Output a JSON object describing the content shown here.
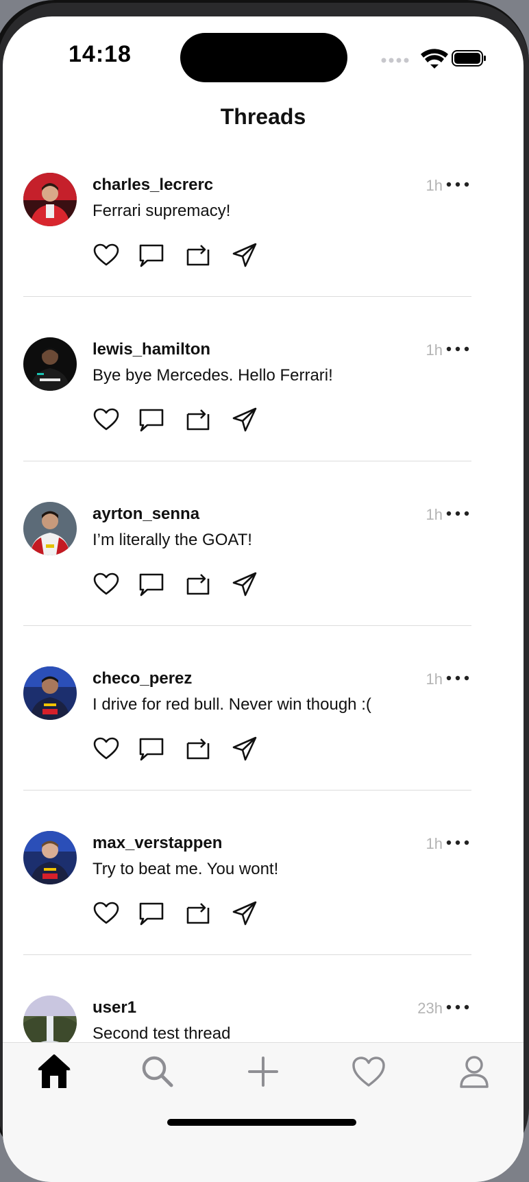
{
  "status_bar": {
    "time": "14:18"
  },
  "nav": {
    "title": "Threads"
  },
  "threads": [
    {
      "username": "charles_lecrerc",
      "time": "1h",
      "content": "Ferrari supremacy!",
      "avatar": "avatar-red-suit"
    },
    {
      "username": "lewis_hamilton",
      "time": "1h",
      "content": "Bye bye Mercedes. Hello Ferrari!",
      "avatar": "avatar-black-suit"
    },
    {
      "username": "ayrton_senna",
      "time": "1h",
      "content": "I’m literally the GOAT!",
      "avatar": "avatar-red-white-suit"
    },
    {
      "username": "checo_perez",
      "time": "1h",
      "content": "I drive for red bull. Never win though :(",
      "avatar": "avatar-redbull-suit"
    },
    {
      "username": "max_verstappen",
      "time": "1h",
      "content": "Try to beat me. You wont!",
      "avatar": "avatar-redbull-suit"
    },
    {
      "username": "user1",
      "time": "23h",
      "content": "Second test thread",
      "avatar": "avatar-waterfall"
    }
  ],
  "action_icons": [
    "heart-icon",
    "comment-icon",
    "repost-icon",
    "send-icon"
  ],
  "tabs": [
    "home-icon",
    "search-icon",
    "plus-icon",
    "heart-icon",
    "profile-icon"
  ],
  "colors": {
    "muted_time": "#b4b4b4",
    "divider": "#dcdcdc",
    "inactive_tab": "#8e8e93",
    "active_tab": "#000000"
  }
}
